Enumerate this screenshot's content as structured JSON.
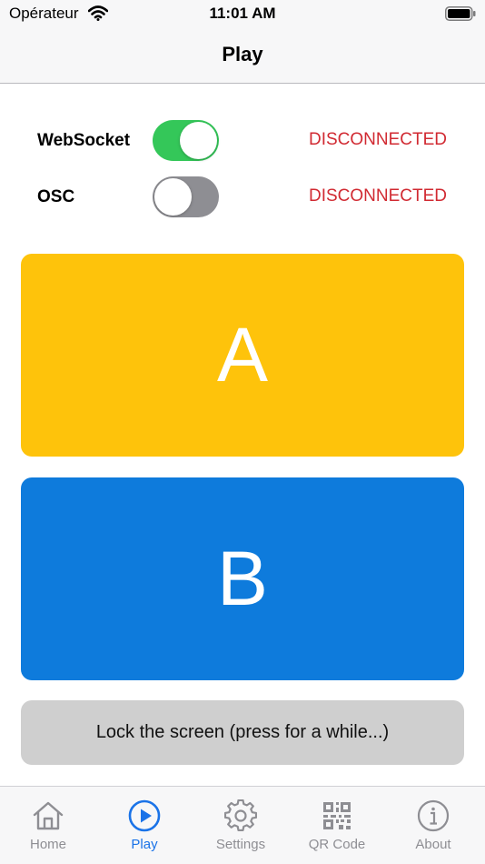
{
  "status_bar": {
    "carrier": "Opérateur",
    "time": "11:01 AM"
  },
  "nav": {
    "title": "Play"
  },
  "connections": [
    {
      "label": "WebSocket",
      "enabled": true,
      "status": "DISCONNECTED"
    },
    {
      "label": "OSC",
      "enabled": false,
      "status": "DISCONNECTED"
    }
  ],
  "buttons": {
    "a_label": "A",
    "b_label": "B",
    "lock_label": "Lock the screen (press for a while...)"
  },
  "colors": {
    "toggle_on": "#34c759",
    "toggle_off": "#8e8e93",
    "status_disconnected": "#d12a32",
    "button_a": "#fec30b",
    "button_b": "#0e7bdc",
    "lock_button": "#cfcfcf",
    "tab_active": "#1a73e8",
    "tab_inactive": "#8e8e93"
  },
  "tab_bar": {
    "active": "Play",
    "items": [
      {
        "label": "Home",
        "icon": "home-icon"
      },
      {
        "label": "Play",
        "icon": "play-circle-icon"
      },
      {
        "label": "Settings",
        "icon": "gear-icon"
      },
      {
        "label": "QR Code",
        "icon": "qr-code-icon"
      },
      {
        "label": "About",
        "icon": "info-icon"
      }
    ]
  }
}
